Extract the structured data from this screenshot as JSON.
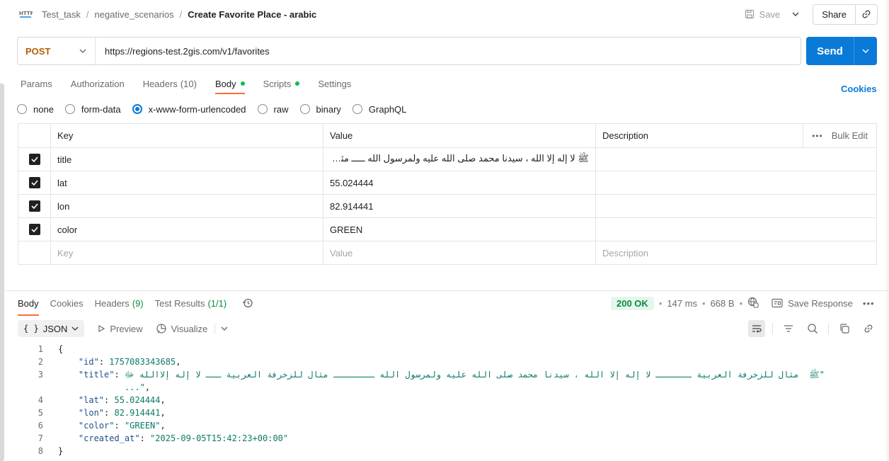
{
  "breadcrumb": {
    "items": [
      "Test_task",
      "negative_scenarios"
    ],
    "current": "Create Favorite Place - arabic"
  },
  "header": {
    "save_label": "Save",
    "share_label": "Share"
  },
  "request": {
    "method": "POST",
    "url": "https://regions-test.2gis.com/v1/favorites",
    "send_label": "Send"
  },
  "tabs": [
    {
      "label": "Params"
    },
    {
      "label": "Authorization"
    },
    {
      "label": "Headers",
      "count": "(10)"
    },
    {
      "label": "Body",
      "active": true
    },
    {
      "label": "Scripts"
    },
    {
      "label": "Settings"
    }
  ],
  "cookies_label": "Cookies",
  "body_types": [
    "none",
    "form-data",
    "x-www-form-urlencoded",
    "raw",
    "binary",
    "GraphQL"
  ],
  "table": {
    "headers": {
      "key": "Key",
      "value": "Value",
      "description": "Description",
      "bulk_edit": "Bulk Edit"
    },
    "rows": [
      {
        "key": "title",
        "value": "ﷺ لا إله إلا الله ، سيدنا محمد صلى الله عليه ولمرسول الله ـــــ مثال للزخرفة العربية ـ لا إله إلاالله ﷻ"
      },
      {
        "key": "lat",
        "value": "55.024444"
      },
      {
        "key": "lon",
        "value": "82.914441"
      },
      {
        "key": "color",
        "value": "GREEN"
      }
    ],
    "placeholders": {
      "key": "Key",
      "value": "Value",
      "description": "Description"
    }
  },
  "response": {
    "tabs": [
      {
        "label": "Body",
        "active": true
      },
      {
        "label": "Cookies"
      },
      {
        "label": "Headers",
        "count": "(9)"
      },
      {
        "label": "Test Results",
        "count": "(1/1)"
      }
    ],
    "status": "200 OK",
    "time": "147 ms",
    "size": "668 B",
    "save_response_label": "Save Response",
    "format": "JSON",
    "preview_label": "Preview",
    "visualize_label": "Visualize",
    "lines": {
      "l1": "{",
      "id_key": "\"id\"",
      "id_val": "1757083343685",
      "title_key": "\"title\"",
      "title_val": "\"ﷺ  مثال للزخرفة العربية ـــــــ لا إله إلا الله ، سيدنا محمد صلى الله عليه ولمرسول الله ــــــــ مثال للزخرفة العربية ـــ لا إله إلاالله ﷻ",
      "title_val2": "    ...\"",
      "lat_key": "\"lat\"",
      "lat_val": "55.024444",
      "lon_key": "\"lon\"",
      "lon_val": "82.914441",
      "color_key": "\"color\"",
      "color_val": "\"GREEN\"",
      "created_key": "\"created_at\"",
      "created_val": "\"2025-09-05T15:42:23+00:00\"",
      "l8": "}"
    },
    "line_numbers": [
      "1",
      "2",
      "3",
      "4",
      "5",
      "6",
      "7",
      "8"
    ]
  },
  "colors": {
    "accent": "#ff6c37",
    "primary": "#0a7ad9",
    "method": "#b35f00",
    "success": "#0cbb52"
  }
}
